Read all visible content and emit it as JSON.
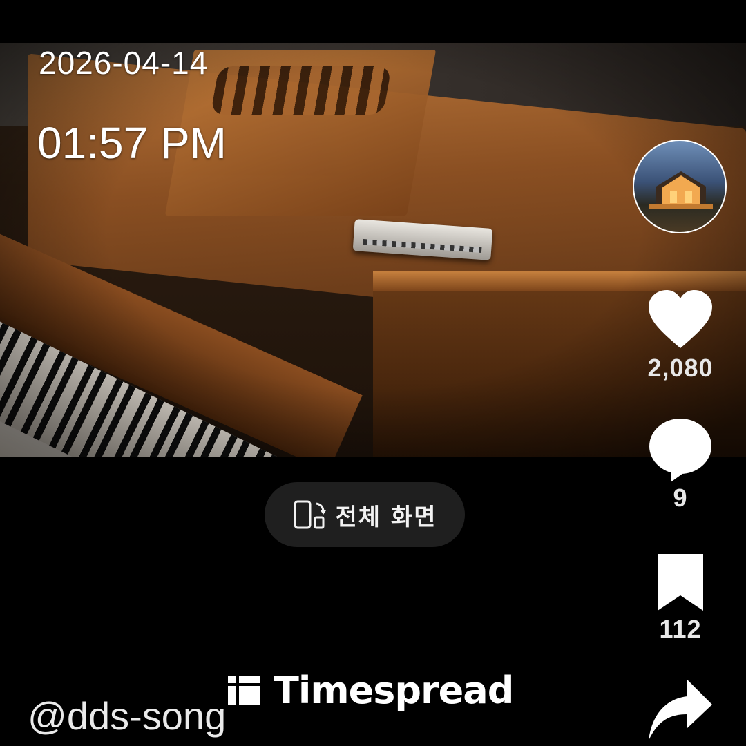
{
  "overlay": {
    "date": "2026-04-14",
    "time": "01:57 PM"
  },
  "rail": {
    "avatar_alt": "profile",
    "likes": "2,080",
    "comments": "9",
    "bookmarks": "112"
  },
  "fullscreen_button": {
    "label": "전체 화면"
  },
  "watermark": {
    "brand": "Timespread"
  },
  "author": {
    "handle": "@dds-song"
  },
  "colors": {
    "background": "#000000",
    "pill": "#1f1f1f",
    "icon": "#ffffff"
  }
}
